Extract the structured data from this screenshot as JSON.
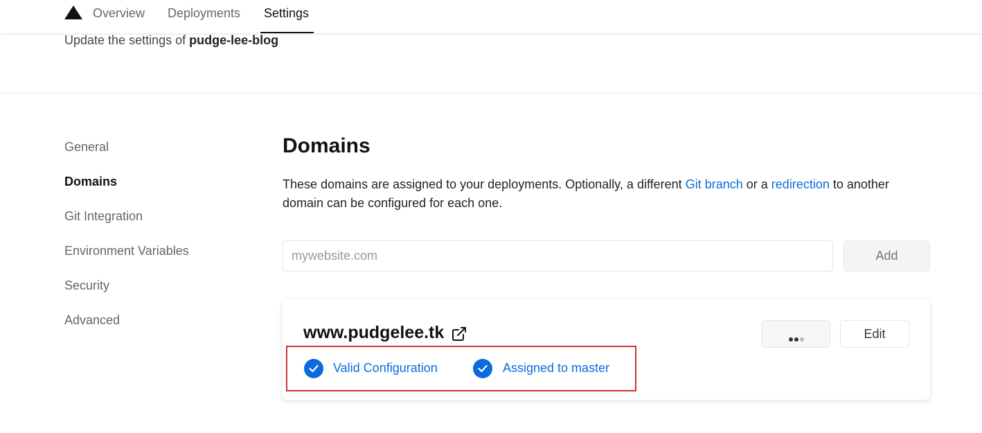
{
  "nav": {
    "tabs": [
      {
        "label": "Overview"
      },
      {
        "label": "Deployments"
      },
      {
        "label": "Settings"
      }
    ]
  },
  "header": {
    "subtitle_prefix": "Update the settings of",
    "project_name": "pudge-lee-blog"
  },
  "sidebar": {
    "items": [
      {
        "label": "General"
      },
      {
        "label": "Domains"
      },
      {
        "label": "Git Integration"
      },
      {
        "label": "Environment Variables"
      },
      {
        "label": "Security"
      },
      {
        "label": "Advanced"
      }
    ]
  },
  "main": {
    "title": "Domains",
    "description": {
      "part1": "These domains are assigned to your deployments. Optionally, a different",
      "link1": "Git branch",
      "part2": "or a",
      "link2": "redirection",
      "part3": "to another domain can be configured for each one."
    },
    "input": {
      "placeholder": "mywebsite.com",
      "value": ""
    },
    "add_label": "Add",
    "domain_card": {
      "domain": "www.pudgelee.tk",
      "edit_label": "Edit",
      "statuses": [
        {
          "label": "Valid Configuration"
        },
        {
          "label": "Assigned to master"
        }
      ]
    }
  },
  "colors": {
    "accent": "#0b6bdc",
    "highlight_border": "#d32f2f"
  },
  "icons": {
    "logo": "triangle-logo-icon",
    "external": "external-link-icon",
    "more": "more-dots-icon",
    "check": "check-circle-icon"
  }
}
